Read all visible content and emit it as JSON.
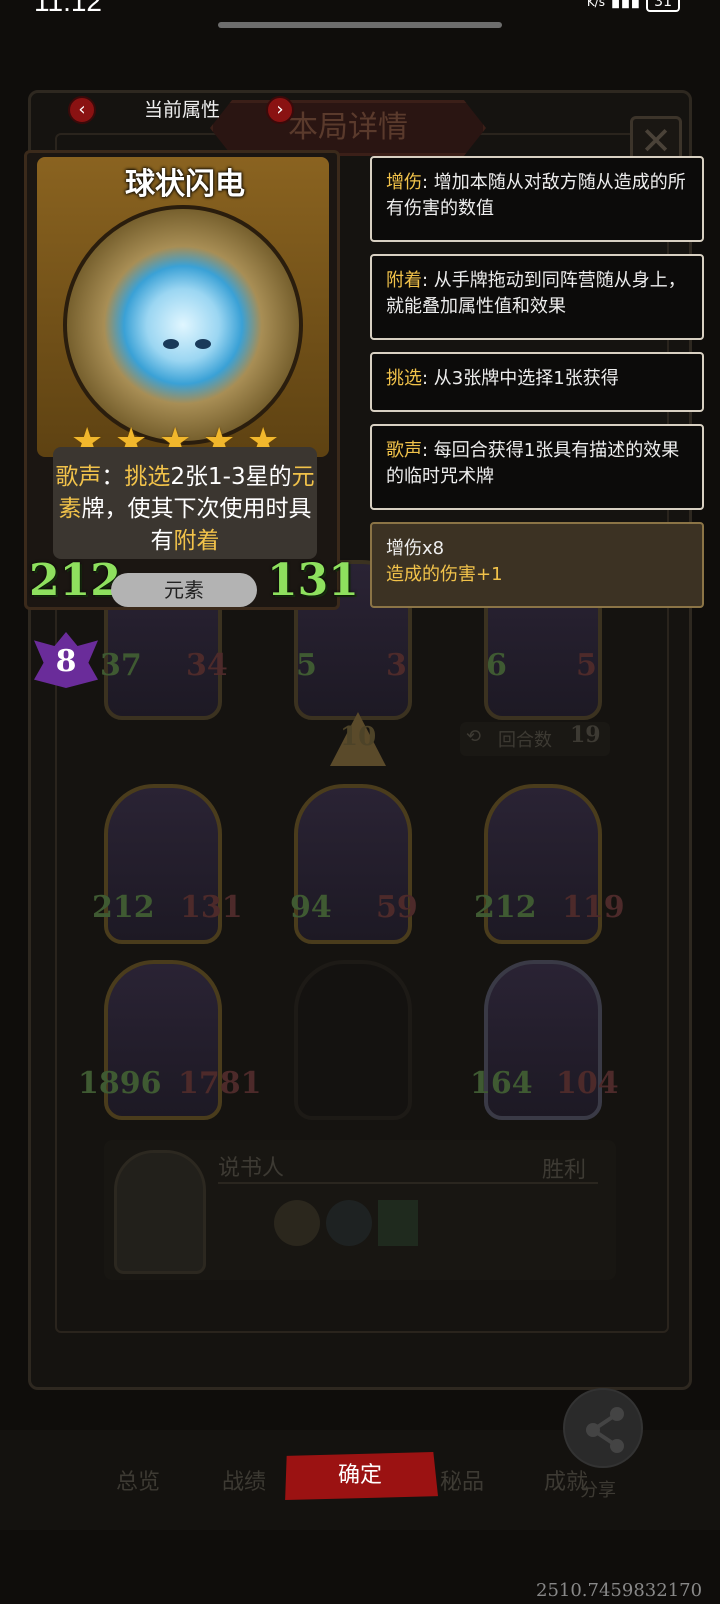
{
  "status": {
    "time": "11:12",
    "net_unit": "K/s",
    "battery": "31"
  },
  "modal": {
    "title": "本局详情",
    "close": "✕"
  },
  "nav": {
    "prev": "‹",
    "current": "当前属性",
    "next": "›"
  },
  "card": {
    "name": "球状闪电",
    "stars": 5,
    "desc_parts": [
      "歌声",
      "：",
      "挑选",
      "2张1-3星的",
      "元素",
      "牌，使其下次使用时具有",
      "附着"
    ],
    "attack": "212",
    "health": "131",
    "tribe": "元素",
    "level": "8"
  },
  "tooltips": [
    {
      "kw": "增伤",
      "text": ": 增加本随从对敌方随从造成的所有伤害的数值"
    },
    {
      "kw": "附着",
      "text": ": 从手牌拖动到同阵营随从身上，就能叠加属性值和效果"
    },
    {
      "kw": "挑选",
      "text": ": 从3张牌中选择1张获得"
    },
    {
      "kw": "歌声",
      "text": ": 每回合获得1张具有描述的效果的临时咒术牌"
    }
  ],
  "buff": {
    "line1": "增伤x8",
    "line2": "造成的伤害+1"
  },
  "board": {
    "row1": [
      {
        "atk": "37",
        "hp": "34"
      },
      {
        "atk": "5",
        "hp": "3"
      },
      {
        "atk": "6",
        "hp": "5"
      }
    ],
    "row2": [
      {
        "atk": "212",
        "hp": "131"
      },
      {
        "atk": "94",
        "hp": "59"
      },
      {
        "atk": "212",
        "hp": "119"
      }
    ],
    "row3": [
      {
        "atk": "1896",
        "hp": "1781"
      },
      {
        "atk": "164",
        "hp": "104"
      }
    ],
    "turn_marker": "10",
    "rounds_label": "回合数",
    "rounds_value": "19"
  },
  "opponent": {
    "name": "说书人",
    "result": "胜利"
  },
  "bottom": {
    "confirm": "确定",
    "share": "分享",
    "tabs": [
      "总览",
      "战绩",
      "秘品",
      "成就"
    ]
  },
  "coords": "2510.7459832170"
}
